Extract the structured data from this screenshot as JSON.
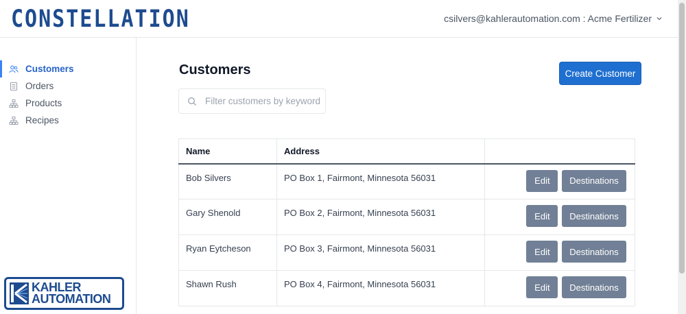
{
  "header": {
    "logo": "CONSTELLATION",
    "user": "csilvers@kahlerautomation.com : Acme Fertilizer"
  },
  "sidebar": {
    "items": [
      {
        "label": "Customers",
        "icon": "users-icon",
        "active": true
      },
      {
        "label": "Orders",
        "icon": "receipt-icon",
        "active": false
      },
      {
        "label": "Products",
        "icon": "hierarchy-icon",
        "active": false
      },
      {
        "label": "Recipes",
        "icon": "hierarchy-icon",
        "active": false
      }
    ],
    "brand": {
      "line1": "KAHLER",
      "line2": "AUTOMATION"
    }
  },
  "main": {
    "title": "Customers",
    "create_label": "Create Customer",
    "search_placeholder": "Filter customers by keyword",
    "table": {
      "columns": [
        "Name",
        "Address",
        ""
      ],
      "rows": [
        {
          "name": "Bob Silvers",
          "address": "PO Box 1, Fairmont, Minnesota 56031"
        },
        {
          "name": "Gary Shenold",
          "address": "PO Box 2, Fairmont, Minnesota 56031"
        },
        {
          "name": "Ryan Eytcheson",
          "address": "PO Box 3, Fairmont, Minnesota 56031"
        },
        {
          "name": "Shawn Rush",
          "address": "PO Box 4, Fairmont, Minnesota 56031"
        }
      ],
      "edit_label": "Edit",
      "destinations_label": "Destinations"
    }
  },
  "colors": {
    "accent": "#1f6fd1",
    "active_nav": "#2563c9",
    "action_button": "#718096",
    "brand": "#1d4b8f"
  }
}
